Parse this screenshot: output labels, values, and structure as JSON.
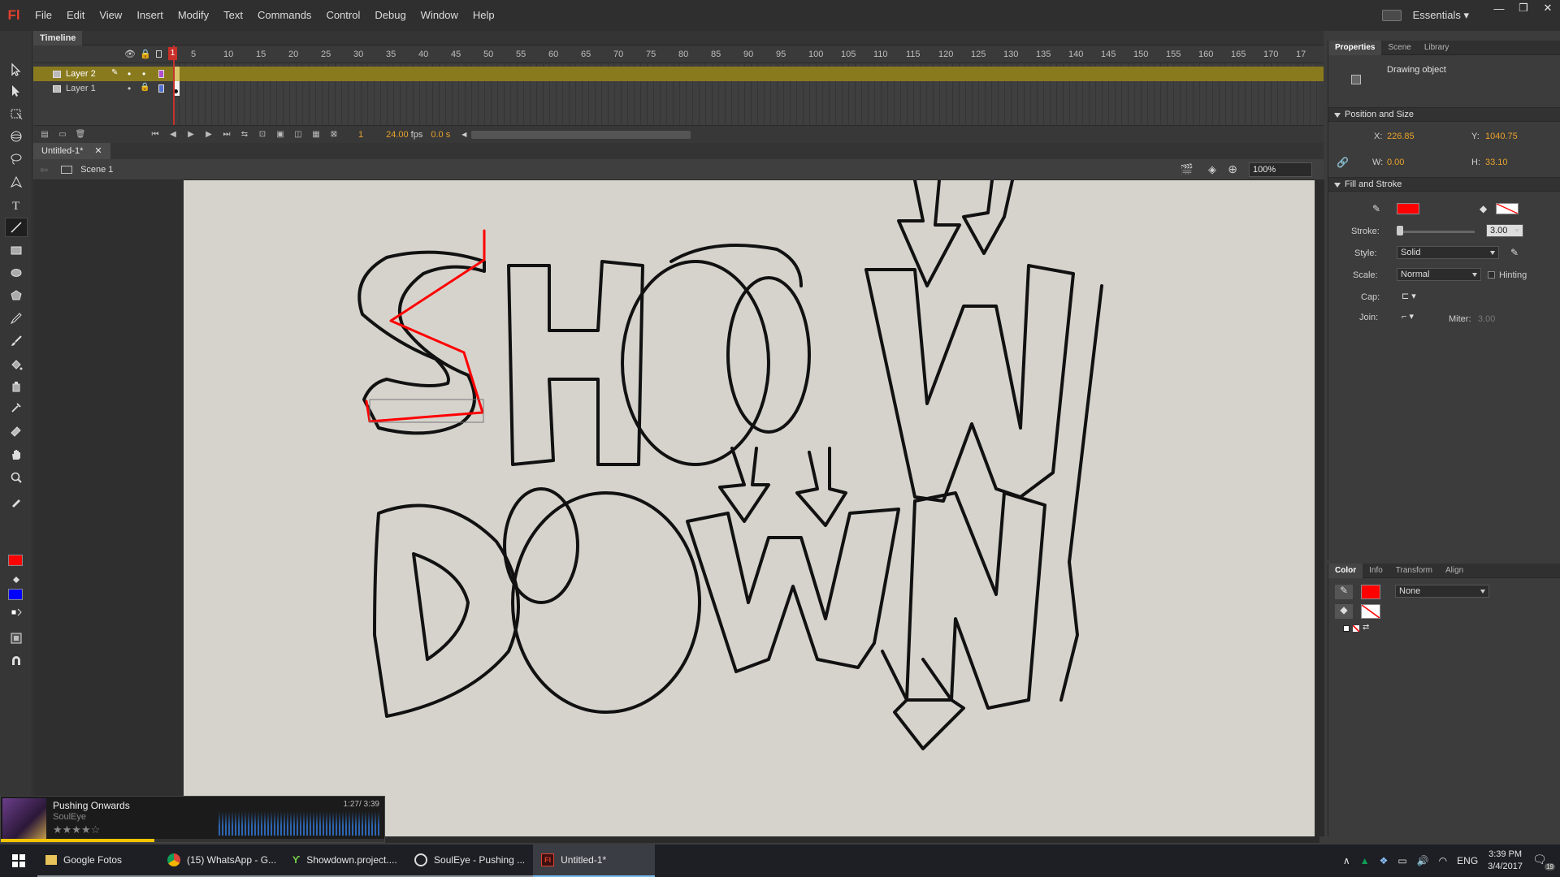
{
  "app": {
    "logo": "Fl",
    "menus": [
      "File",
      "Edit",
      "View",
      "Insert",
      "Modify",
      "Text",
      "Commands",
      "Control",
      "Debug",
      "Window",
      "Help"
    ],
    "workspace": "Essentials"
  },
  "timeline": {
    "tab": "Timeline",
    "frame_numbers": [
      "1",
      "5",
      "10",
      "15",
      "20",
      "25",
      "30",
      "35",
      "40",
      "45",
      "50",
      "55",
      "60",
      "65",
      "70",
      "75",
      "80",
      "85",
      "90",
      "95",
      "100",
      "105",
      "110",
      "115",
      "120",
      "125",
      "130",
      "135",
      "140",
      "145",
      "150",
      "155",
      "160",
      "165",
      "170",
      "17"
    ],
    "layers": [
      {
        "name": "Layer 2",
        "selected": true,
        "color": "#b14fd1"
      },
      {
        "name": "Layer 1",
        "selected": false,
        "color": "#4f6fd1"
      }
    ],
    "current_frame": "1",
    "fps": "24.00",
    "fps_unit": "fps",
    "time": "0.0 s"
  },
  "document": {
    "tab": "Untitled-1*",
    "scene": "Scene 1",
    "zoom": "100%"
  },
  "properties": {
    "tabs": [
      "Properties",
      "Scene",
      "Library"
    ],
    "object_type": "Drawing object",
    "position_section": "Position and Size",
    "x_label": "X:",
    "x": "226.85",
    "y_label": "Y:",
    "y": "1040.75",
    "w_label": "W:",
    "w": "0.00",
    "h_label": "H:",
    "h": "33.10",
    "fill_section": "Fill and Stroke",
    "stroke_label": "Stroke:",
    "stroke": "3.00",
    "style_label": "Style:",
    "style": "Solid",
    "scale_label": "Scale:",
    "scale": "Normal",
    "hinting": "Hinting",
    "cap_label": "Cap:",
    "join_label": "Join:",
    "miter_label": "Miter:",
    "miter": "3.00",
    "stroke_color": "#ff0000"
  },
  "color_panel": {
    "tabs": [
      "Color",
      "Info",
      "Transform",
      "Align"
    ],
    "fill_type": "None",
    "stroke_color": "#ff0000"
  },
  "media": {
    "title": "Pushing Onwards",
    "artist": "SoulEye",
    "time": "1:27/ 3:39",
    "rating_stars": 4,
    "progress": 0.4
  },
  "taskbar": {
    "apps": [
      {
        "label": "Google Fotos",
        "icon": "folder-icon"
      },
      {
        "label": "(15) WhatsApp - G...",
        "icon": "chrome-icon"
      },
      {
        "label": "Showdown.project....",
        "icon": "project-icon"
      },
      {
        "label": "SoulEye - Pushing ...",
        "icon": "music-icon"
      },
      {
        "label": "Untitled-1*",
        "icon": "flash-icon"
      }
    ],
    "language": "ENG",
    "time": "3:39 PM",
    "date": "3/4/2017",
    "notifications": "19"
  },
  "colors": {
    "accent_red": "#ff0000",
    "flash_red": "#e2402d",
    "selection": "#8a7a1e"
  }
}
